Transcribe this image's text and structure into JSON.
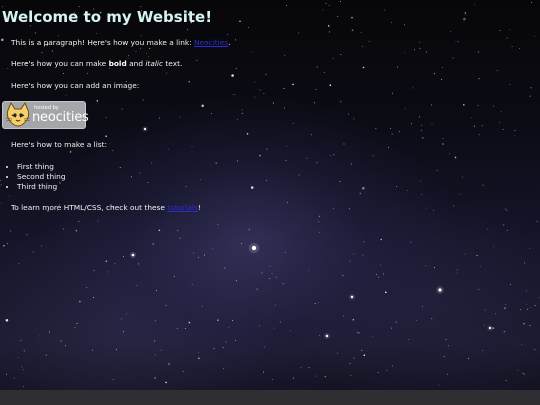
{
  "page": {
    "heading": "Welcome to my Website!",
    "p1": {
      "before": "This is a paragraph! Here's how you make a link: ",
      "link": "Neocities",
      "after": "."
    },
    "p2": {
      "before": "Here's how you can make ",
      "bold": "bold",
      "middle": " and ",
      "italic": "italic",
      "after": " text."
    },
    "p3": "Here's how you can add an image:",
    "badge": {
      "small": "hosted by",
      "big": "neocities"
    },
    "p4": "Here's how to make a list:",
    "list": [
      "First thing",
      "Second thing",
      "Third thing"
    ],
    "p5": {
      "before": "To learn more HTML/CSS, check out these ",
      "link": "tutorials",
      "after": "!"
    }
  },
  "colors": {
    "heading": "#d6f3f4",
    "text": "#f2f2f2",
    "link": "#2c2cd6",
    "background": "#000000",
    "bottom_bar": "#2f2f33"
  }
}
